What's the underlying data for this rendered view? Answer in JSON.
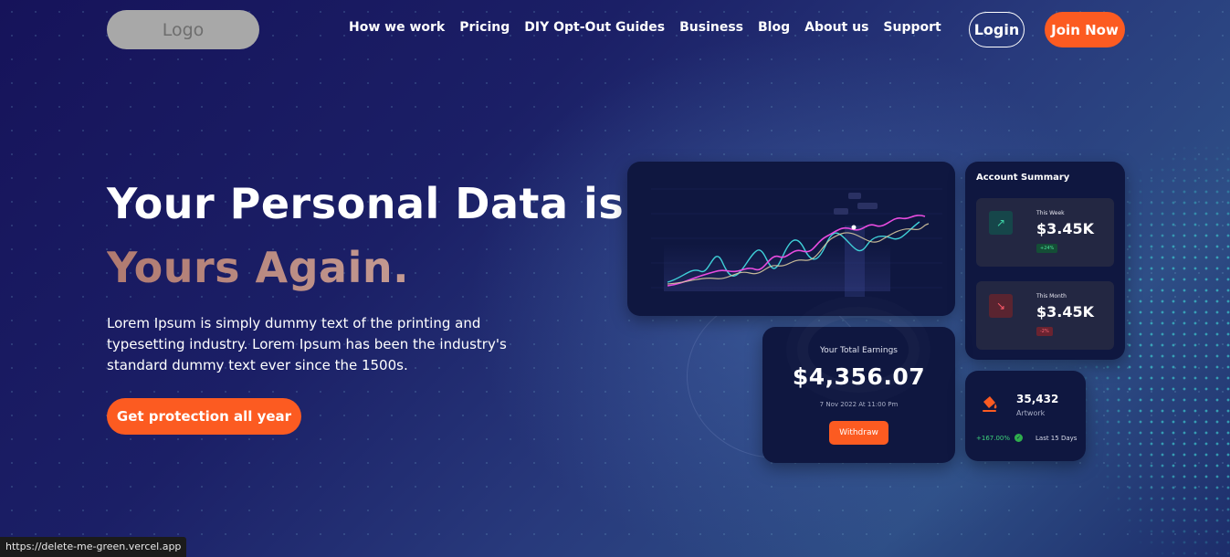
{
  "header": {
    "logo_text": "Logo",
    "nav": [
      {
        "label": "How we work"
      },
      {
        "label": "Pricing"
      },
      {
        "label": "DIY Opt-Out Guides"
      },
      {
        "label": "Business"
      },
      {
        "label": "Blog"
      },
      {
        "label": "About us"
      },
      {
        "label": "Support"
      }
    ],
    "login_label": "Login",
    "join_label": "Join Now"
  },
  "hero": {
    "title_line1": "Your Personal Data is",
    "title_line2": "Yours Again.",
    "description": "Lorem Ipsum is simply dummy text of the printing and typesetting industry. Lorem Ipsum has been the industry's standard dummy text ever since the 1500s.",
    "cta_label": "Get protection all year"
  },
  "dashboard": {
    "account_summary": {
      "title": "Account Summary",
      "this_week": {
        "label": "This Week",
        "amount": "$3.45K",
        "change": "+24%"
      },
      "this_month": {
        "label": "This Month",
        "amount": "$3.45K",
        "change": "-2%"
      }
    },
    "earnings": {
      "title": "Your Total Earnings",
      "value": "$4,356.07",
      "date": "7 Nov 2022 At 11:00 Pm",
      "withdraw_label": "Withdraw"
    },
    "artwork": {
      "value": "35,432",
      "label": "Artwork",
      "growth": "+167.00%",
      "period": "Last 15 Days"
    }
  },
  "colors": {
    "accent": "#fc5b21",
    "background_dark": "#16135a",
    "card_bg": "#0f1740",
    "chart_pink": "#e94ce0",
    "chart_cyan": "#3fd0d8",
    "chart_sand": "#d8c9a0"
  },
  "status_bar": {
    "url": "https://delete-me-green.vercel.app"
  }
}
